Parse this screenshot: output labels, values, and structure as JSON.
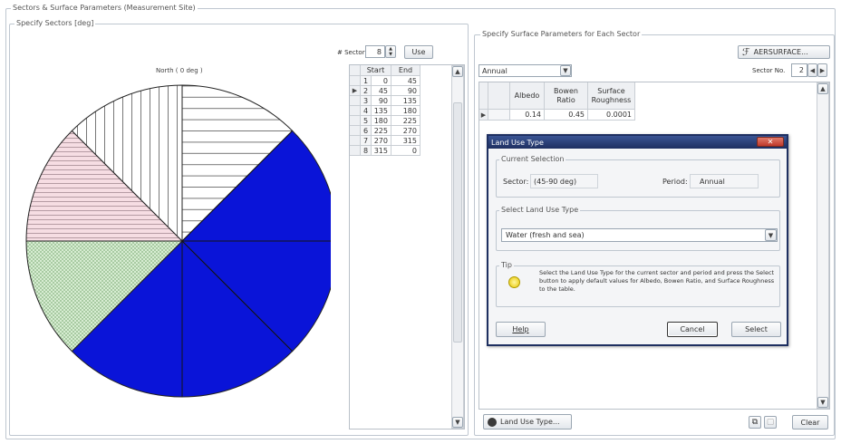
{
  "outer": {
    "title": "Sectors & Surface Parameters (Measurement Site)"
  },
  "left": {
    "legend": "Specify Sectors [deg]",
    "pie_north_label": "North ( 0 deg )",
    "sectors_label": "# Sectors",
    "sectors_value": "8",
    "use_button": "Use",
    "table": {
      "headers": [
        "Start",
        "End"
      ],
      "rows": [
        [
          "1",
          "0",
          "45"
        ],
        [
          "2",
          "45",
          "90"
        ],
        [
          "3",
          "90",
          "135"
        ],
        [
          "4",
          "135",
          "180"
        ],
        [
          "5",
          "180",
          "225"
        ],
        [
          "6",
          "225",
          "270"
        ],
        [
          "7",
          "270",
          "315"
        ],
        [
          "8",
          "315",
          "0"
        ]
      ]
    }
  },
  "right": {
    "legend": "Specify Surface Parameters for Each Sector",
    "aersurface_button": "AERSURFACE...",
    "period_value": "Annual",
    "sector_no_label": "Sector No.",
    "sector_no_value": "2",
    "grid": {
      "headers": [
        "Albedo",
        "Bowen Ratio",
        "Surface Roughness"
      ],
      "row": [
        "0.14",
        "0.45",
        "0.0001"
      ]
    },
    "land_use_button": "Land Use Type...",
    "clear_button": "Clear"
  },
  "dialog": {
    "title": "Land Use Type",
    "current_legend": "Current Selection",
    "sector_label": "Sector:",
    "sector_value": "(45-90 deg)",
    "period_label": "Period:",
    "period_value": "Annual",
    "select_legend": "Select Land Use Type",
    "land_use_value": "Water (fresh and sea)",
    "tip_legend": "Tip",
    "tip_text": "Select the Land Use Type for the current sector and period and press the Select button to apply default values for Albedo, Bowen Ratio, and Surface Roughness to the table.",
    "help_button": "Help",
    "cancel_button": "Cancel",
    "select_button": "Select"
  },
  "colors": {
    "blue_sector": "#0a14d8",
    "green_sector": "#d7edd2",
    "pink_sector": "#f6dde3",
    "dialog_title_bg": "#2a3f7a"
  }
}
